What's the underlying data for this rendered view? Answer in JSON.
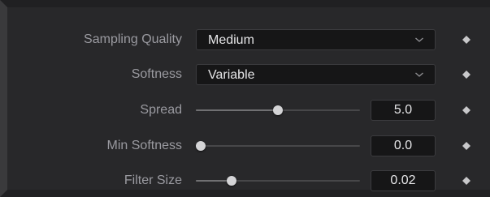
{
  "rows": [
    {
      "label": "Sampling Quality",
      "type": "select",
      "value": "Medium",
      "chevron_icon": "chevron-down-icon",
      "keyframe_icon": "keyframe-diamond-icon"
    },
    {
      "label": "Softness",
      "type": "select",
      "value": "Variable",
      "chevron_icon": "chevron-down-icon",
      "keyframe_icon": "keyframe-diamond-icon"
    },
    {
      "label": "Spread",
      "type": "slider",
      "value": "5.0",
      "slider_fraction": 0.5,
      "keyframe_icon": "keyframe-diamond-icon"
    },
    {
      "label": "Min Softness",
      "type": "slider",
      "value": "0.0",
      "slider_fraction": 0.03,
      "keyframe_icon": "keyframe-diamond-icon"
    },
    {
      "label": "Filter Size",
      "type": "slider",
      "value": "0.02",
      "slider_fraction": 0.22,
      "keyframe_icon": "keyframe-diamond-icon"
    }
  ],
  "colors": {
    "panel_bg": "#28282a",
    "field_bg": "#161617",
    "label_text": "#9a9aa0",
    "value_text": "#e6e6e8",
    "knob": "#d4d4d6",
    "keyframe": "#c8c8ca"
  }
}
